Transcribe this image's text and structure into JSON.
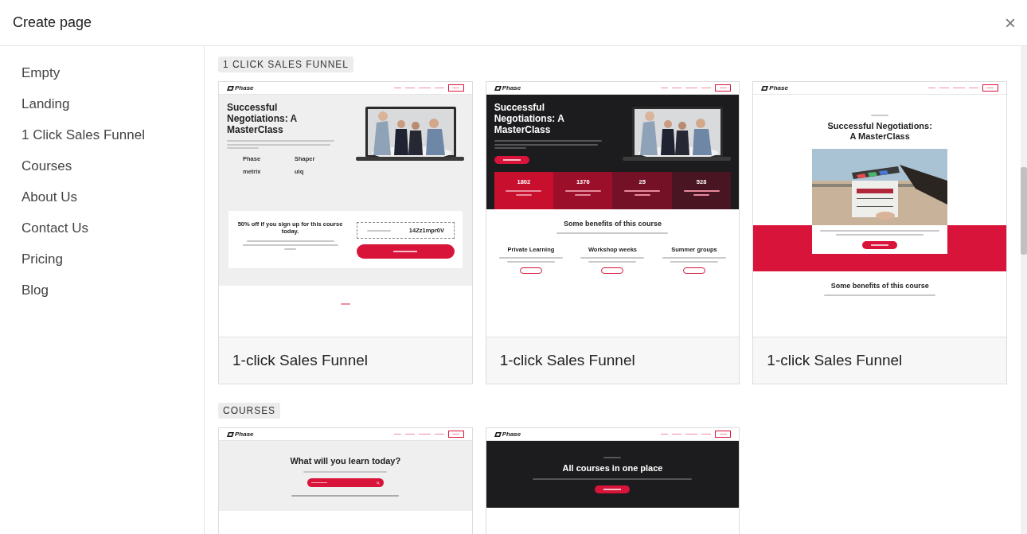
{
  "dialog": {
    "title": "Create page",
    "close": "×"
  },
  "sidebar": {
    "items": [
      {
        "label": "Empty"
      },
      {
        "label": "Landing"
      },
      {
        "label": "1 Click Sales Funnel"
      },
      {
        "label": "Courses"
      },
      {
        "label": "About Us"
      },
      {
        "label": "Contact Us"
      },
      {
        "label": "Pricing"
      },
      {
        "label": "Blog"
      }
    ]
  },
  "sections": [
    {
      "label": "1 CLICK SALES FUNNEL",
      "templates": [
        {
          "name": "1-click Sales Funnel",
          "preview": {
            "kind": "split",
            "dark": false,
            "brand": "Phase",
            "heading": "Successful Negotiations: A MasterClass",
            "logos": [
              "Phase",
              "Shaper",
              "metrix",
              "uiq"
            ],
            "promo": {
              "title": "50% off if you sign up for this course today.",
              "code": "14Zz1mpr0V"
            }
          }
        },
        {
          "name": "1-click Sales Funnel",
          "preview": {
            "kind": "split",
            "dark": true,
            "brand": "Phase",
            "heading": "Successful Negotiations: A MasterClass",
            "stats": [
              "1802",
              "1376",
              "25",
              "528"
            ],
            "benefits": {
              "title": "Some benefits of this course",
              "features": [
                "Private Learning",
                "Workshop weeks",
                "Summer groups"
              ]
            }
          }
        },
        {
          "name": "1-click Sales Funnel",
          "preview": {
            "kind": "centered",
            "dark": false,
            "brand": "Phase",
            "heading": "Successful Negotiations: A MasterClass",
            "benefits": {
              "title": "Some benefits of this course"
            }
          }
        }
      ]
    },
    {
      "label": "COURSES",
      "templates": [
        {
          "preview": {
            "kind": "catalog_search",
            "dark": false,
            "brand": "Phase",
            "heading": "What will you learn today?"
          }
        },
        {
          "preview": {
            "kind": "catalog_banner",
            "dark": true,
            "brand": "Phase",
            "heading": "All courses in one place"
          }
        }
      ]
    }
  ]
}
